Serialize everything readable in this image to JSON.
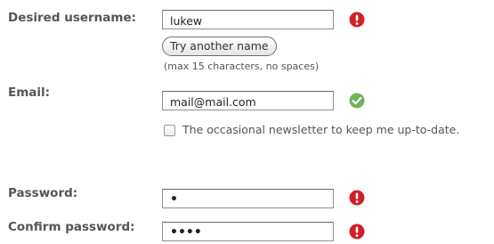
{
  "form": {
    "username": {
      "label": "Desired username:",
      "value": "lukew",
      "status": "error",
      "suggest_button": "Try another name",
      "hint": "(max 15 characters, no spaces)"
    },
    "email": {
      "label": "Email:",
      "value": "mail@mail.com",
      "status": "valid"
    },
    "newsletter": {
      "checked": false,
      "label": "The occasional newsletter to keep me up-to-date."
    },
    "password": {
      "label": "Password:",
      "value": "•",
      "status": "error"
    },
    "confirm_password": {
      "label": "Confirm password:",
      "value": "••••",
      "status": "error"
    }
  },
  "icons": {
    "error": "exclamation-circle-icon",
    "valid": "checkmark-circle-icon"
  },
  "colors": {
    "error": "#d21f26",
    "valid": "#6fb35a",
    "label": "#555555"
  }
}
